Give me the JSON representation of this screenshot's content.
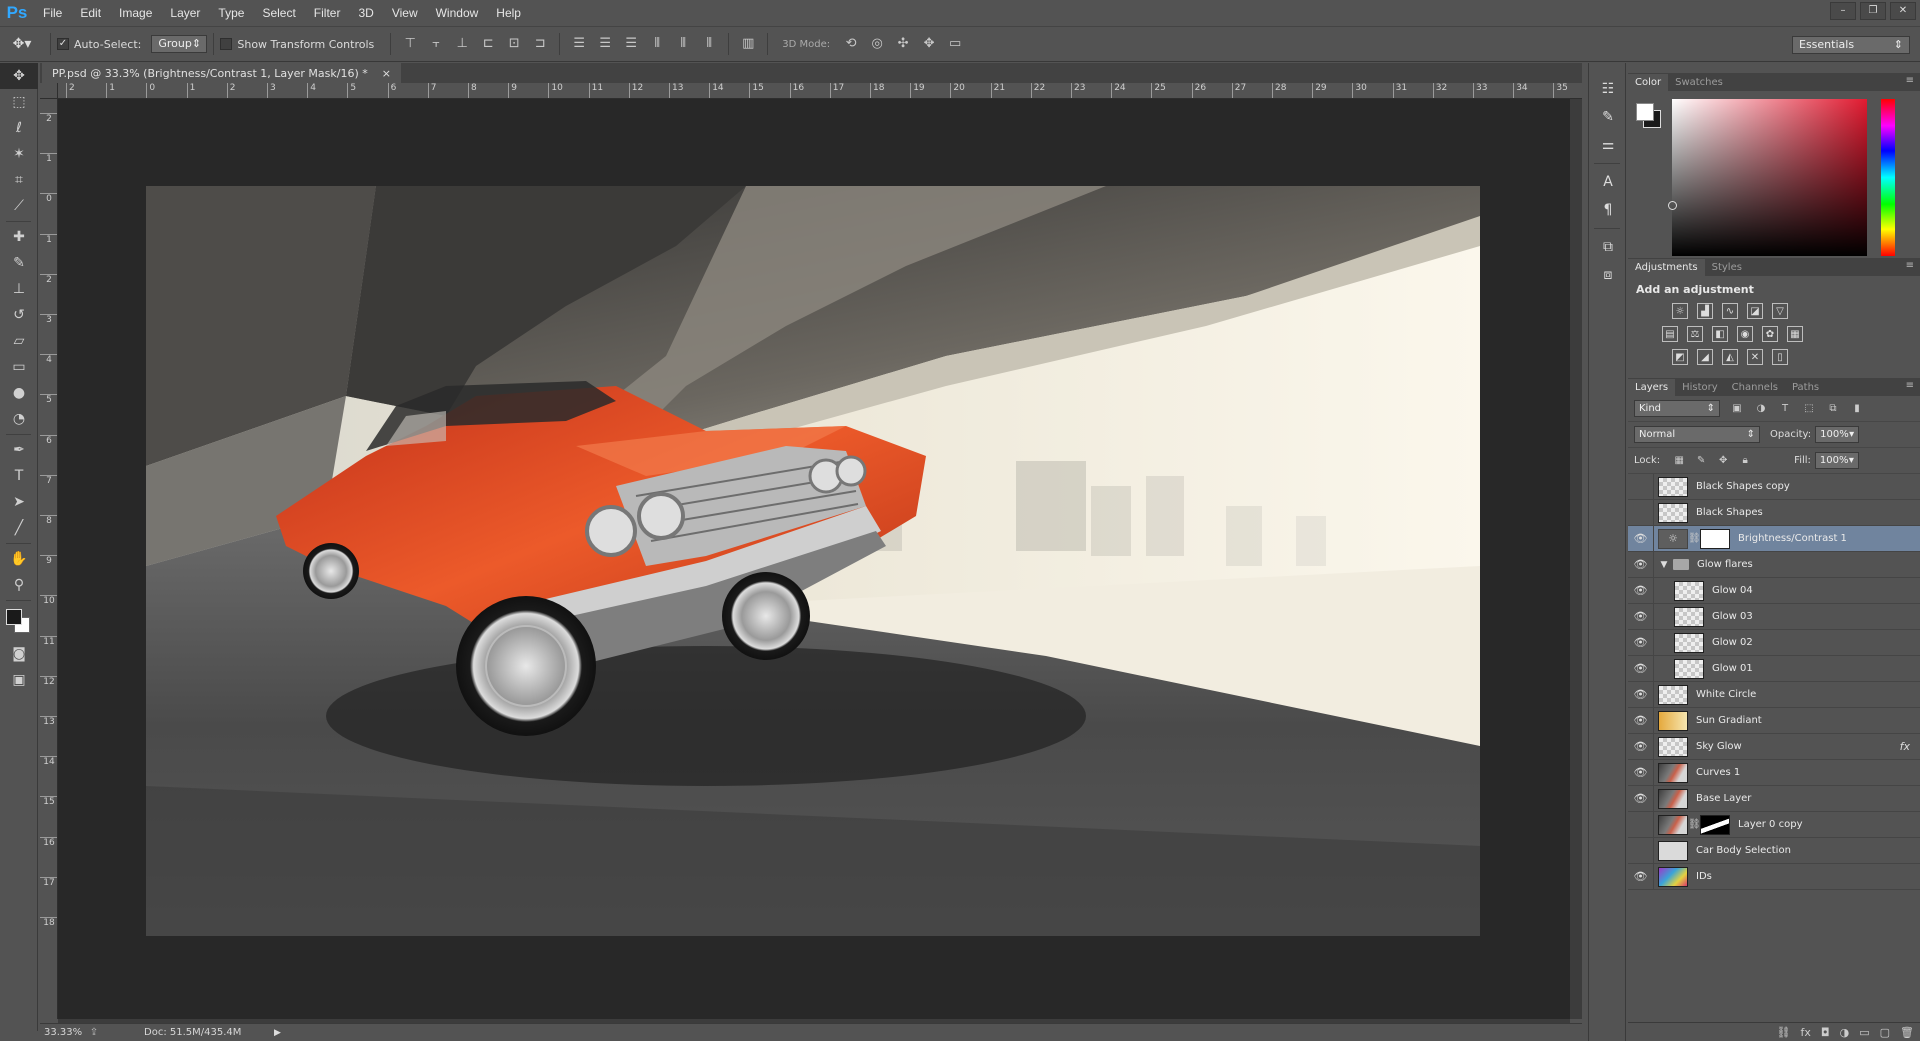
{
  "app": {
    "logo": "Ps",
    "menu": [
      "File",
      "Edit",
      "Image",
      "Layer",
      "Type",
      "Select",
      "Filter",
      "3D",
      "View",
      "Window",
      "Help"
    ],
    "window_controls": [
      "–",
      "❐",
      "✕"
    ]
  },
  "options_bar": {
    "tool_icon": "move-tool-icon",
    "auto_select_label": "Auto-Select:",
    "auto_select_checked": true,
    "auto_select_target": "Group",
    "show_transform_label": "Show Transform Controls",
    "show_transform_checked": false,
    "mode_3d_label": "3D Mode:",
    "workspace": "Essentials"
  },
  "document": {
    "tab_title": "PP.psd @ 33.3% (Brightness/Contrast 1, Layer Mask/16) *",
    "close_glyph": "×",
    "ruler_h": [
      "2",
      "1",
      "0",
      "1",
      "2",
      "3",
      "4",
      "5",
      "6",
      "7",
      "8",
      "9",
      "10",
      "11",
      "12",
      "13",
      "14",
      "15",
      "16",
      "17",
      "18",
      "19",
      "20",
      "21",
      "22",
      "23",
      "24",
      "25",
      "26",
      "27",
      "28",
      "29",
      "30",
      "31",
      "32",
      "33",
      "34",
      "35"
    ],
    "ruler_v": [
      "2",
      "1",
      "0",
      "1",
      "2",
      "3",
      "4",
      "5",
      "6",
      "7",
      "8",
      "9",
      "10",
      "11",
      "12",
      "13",
      "14",
      "15",
      "16",
      "17",
      "18"
    ]
  },
  "status": {
    "zoom": "33.33%",
    "doc_size": "Doc: 51.5M/435.4M"
  },
  "color_panel": {
    "tabs": [
      "Color",
      "Swatches"
    ],
    "fg_color": "#ffffff",
    "bg_color": "#1a1a1a",
    "hue_color": "#e11a30"
  },
  "adjustments_panel": {
    "tabs": [
      "Adjustments",
      "Styles"
    ],
    "title": "Add an adjustment"
  },
  "layers_panel": {
    "tabs": [
      "Layers",
      "History",
      "Channels",
      "Paths"
    ],
    "filter_kind": "Kind",
    "blend_mode": "Normal",
    "opacity_label": "Opacity:",
    "opacity": "100%",
    "lock_label": "Lock:",
    "fill_label": "Fill:",
    "fill": "100%",
    "layers": [
      {
        "name": "Black Shapes copy",
        "visible": false,
        "thumb": "checker"
      },
      {
        "name": "Black Shapes",
        "visible": false,
        "thumb": "checker"
      },
      {
        "name": "Brightness/Contrast 1",
        "visible": true,
        "thumb": "adj",
        "mask": "mask",
        "selected": true
      },
      {
        "name": "Glow flares",
        "visible": true,
        "group": true
      },
      {
        "name": "Glow 04",
        "visible": true,
        "thumb": "checker",
        "indent": true
      },
      {
        "name": "Glow 03",
        "visible": true,
        "thumb": "checker",
        "indent": true
      },
      {
        "name": "Glow 02",
        "visible": true,
        "thumb": "checker",
        "indent": true
      },
      {
        "name": "Glow 01",
        "visible": true,
        "thumb": "checker",
        "indent": true
      },
      {
        "name": "White Circle",
        "visible": true,
        "thumb": "checker"
      },
      {
        "name": "Sun Gradiant",
        "visible": true,
        "thumb": "sun"
      },
      {
        "name": "Sky Glow",
        "visible": true,
        "thumb": "checker",
        "fx": "fx"
      },
      {
        "name": "Curves 1",
        "visible": true,
        "thumb": "img"
      },
      {
        "name": "Base Layer",
        "visible": true,
        "thumb": "img"
      },
      {
        "name": "Layer 0 copy",
        "visible": false,
        "thumb": "img",
        "mask": "mask-blk"
      },
      {
        "name": "Car Body Selection",
        "visible": false,
        "thumb": "carsel"
      },
      {
        "name": "IDs",
        "visible": true,
        "thumb": "ids"
      }
    ]
  },
  "artwork": {
    "description_colors": {
      "car": "#e0441d",
      "sky": "#f3ecd8",
      "concrete": "#3c3c3c"
    }
  }
}
